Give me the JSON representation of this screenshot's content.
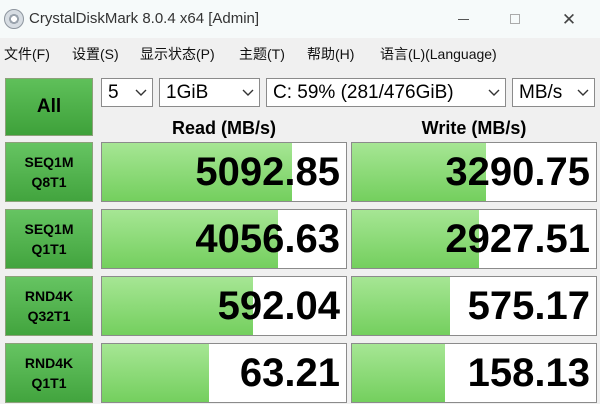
{
  "window": {
    "title": "CrystalDiskMark 8.0.4 x64 [Admin]"
  },
  "menu": [
    "文件(F)",
    "设置(S)",
    "显示状态(P)",
    "主题(T)",
    "帮助(H)",
    "语言(L)(Language)"
  ],
  "controls": {
    "all_label": "All",
    "count": "5",
    "size": "1GiB",
    "drive": "C: 59% (281/476GiB)",
    "unit": "MB/s"
  },
  "headers": {
    "read": "Read (MB/s)",
    "write": "Write (MB/s)"
  },
  "tests": [
    {
      "line1": "SEQ1M",
      "line2": "Q8T1",
      "read": "5092.85",
      "write": "3290.75",
      "read_fill": 0.78,
      "write_fill": 0.55
    },
    {
      "line1": "SEQ1M",
      "line2": "Q1T1",
      "read": "4056.63",
      "write": "2927.51",
      "read_fill": 0.72,
      "write_fill": 0.52
    },
    {
      "line1": "RND4K",
      "line2": "Q32T1",
      "read": "592.04",
      "write": "575.17",
      "read_fill": 0.62,
      "write_fill": 0.4
    },
    {
      "line1": "RND4K",
      "line2": "Q1T1",
      "read": "63.21",
      "write": "158.13",
      "read_fill": 0.44,
      "write_fill": 0.38
    }
  ],
  "colors": {
    "button_green": "#4caf46",
    "bar_green": "#8edc78"
  }
}
